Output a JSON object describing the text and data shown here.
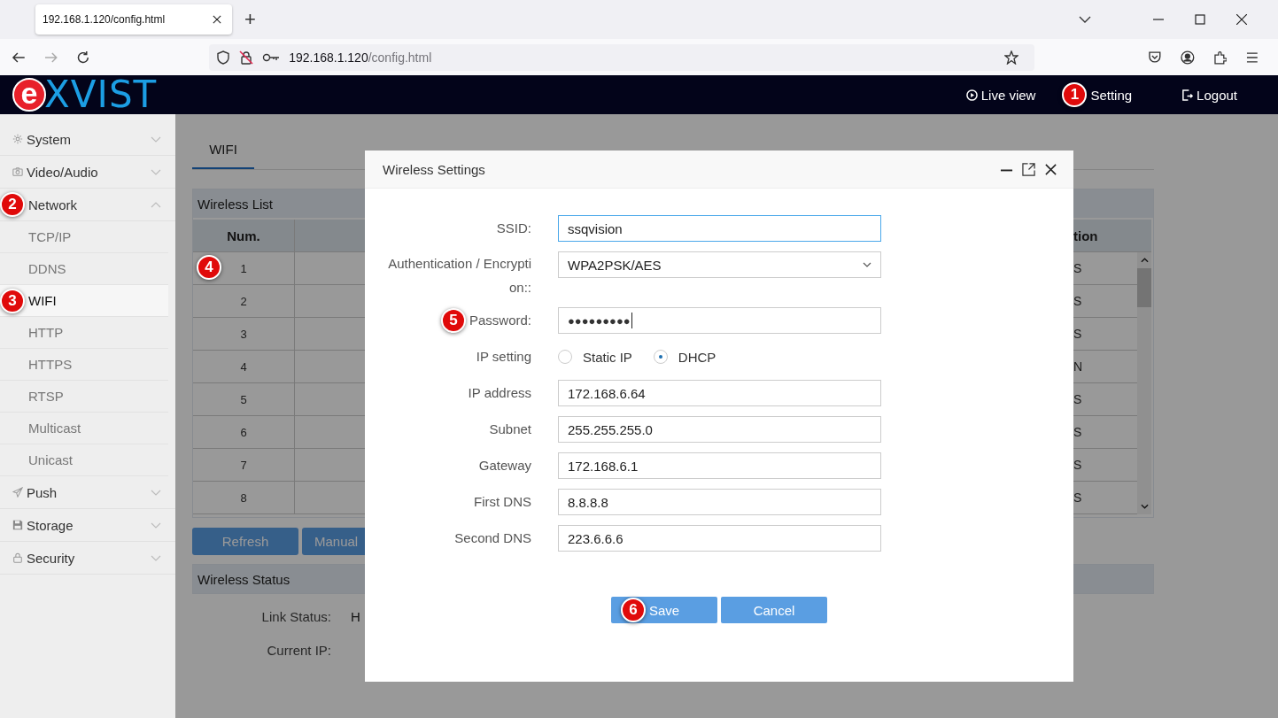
{
  "browser": {
    "tab": {
      "title": "192.168.1.120/config.html"
    },
    "new_tab": "+",
    "url": {
      "host": "192.168.1.120",
      "path": "/config.html"
    }
  },
  "header": {
    "logo": {
      "mark": "e",
      "text": "XVIST"
    },
    "nav": [
      {
        "label": "Live view",
        "kind": "play"
      },
      {
        "label": "Setting",
        "badge": "1"
      },
      {
        "label": "Logout",
        "kind": "logout"
      }
    ]
  },
  "sidebar": {
    "items": [
      {
        "label": "System",
        "kind": "gear",
        "expanded": false
      },
      {
        "label": "Video/Audio",
        "kind": "camera",
        "expanded": false
      },
      {
        "label": "Network",
        "badge": "2",
        "expanded": true,
        "children": [
          {
            "label": "TCP/IP",
            "selected": false
          },
          {
            "label": "DDNS",
            "selected": false
          },
          {
            "label": "WIFI",
            "selected": true,
            "badge": "3"
          },
          {
            "label": "HTTP",
            "selected": false
          },
          {
            "label": "HTTPS",
            "selected": false
          },
          {
            "label": "RTSP",
            "selected": false
          },
          {
            "label": "Multicast",
            "selected": false
          },
          {
            "label": "Unicast",
            "selected": false
          }
        ]
      },
      {
        "label": "Push",
        "kind": "plane",
        "expanded": false
      },
      {
        "label": "Storage",
        "kind": "floppy",
        "expanded": false
      },
      {
        "label": "Security",
        "kind": "lock",
        "expanded": false
      }
    ]
  },
  "main": {
    "tabs": [
      {
        "label": "WIFI",
        "selected": true
      }
    ],
    "wireless_list": {
      "title": "Wireless List",
      "columns": [
        "Num.",
        "tion"
      ],
      "rows": [
        {
          "num": "1",
          "last": "S",
          "badge": "4"
        },
        {
          "num": "2",
          "last": "S"
        },
        {
          "num": "3",
          "last": "S"
        },
        {
          "num": "4",
          "last": "N"
        },
        {
          "num": "5",
          "last": "S"
        },
        {
          "num": "6",
          "last": "S"
        },
        {
          "num": "7",
          "last": "S"
        },
        {
          "num": "8",
          "last": "S"
        }
      ]
    },
    "buttons": [
      "Refresh",
      "Manual"
    ],
    "wireless_status": {
      "title": "Wireless Status",
      "rows": [
        {
          "label": "Link Status:",
          "value": "H"
        },
        {
          "label": "Current IP:"
        }
      ]
    }
  },
  "dialog": {
    "title": "Wireless Settings",
    "fields": [
      {
        "kind": "text",
        "label": "SSID:",
        "value": "ssqvision",
        "focused": true
      },
      {
        "kind": "select",
        "label": "Authentication / Encryption::",
        "value": "WPA2PSK/AES",
        "focused": false
      },
      {
        "kind": "password",
        "label": "Password:",
        "value": "●●●●●●●●●",
        "focused": false,
        "badge": "5"
      },
      {
        "kind": "radio",
        "label": "IP setting",
        "options": [
          {
            "label": "Static IP",
            "selected": false
          },
          {
            "label": "DHCP",
            "selected": true
          }
        ]
      },
      {
        "kind": "text",
        "label": "IP address",
        "value": "172.168.6.64",
        "focused": false
      },
      {
        "kind": "text",
        "label": "Subnet",
        "value": "255.255.255.0",
        "focused": false
      },
      {
        "kind": "text",
        "label": "Gateway",
        "value": "172.168.6.1",
        "focused": false
      },
      {
        "kind": "text",
        "label": "First DNS",
        "value": "8.8.8.8",
        "focused": false
      },
      {
        "kind": "text",
        "label": "Second DNS",
        "value": "223.6.6.6",
        "focused": false
      }
    ],
    "buttons": [
      {
        "label": "Save",
        "badge": "6"
      },
      {
        "label": "Cancel"
      }
    ]
  }
}
